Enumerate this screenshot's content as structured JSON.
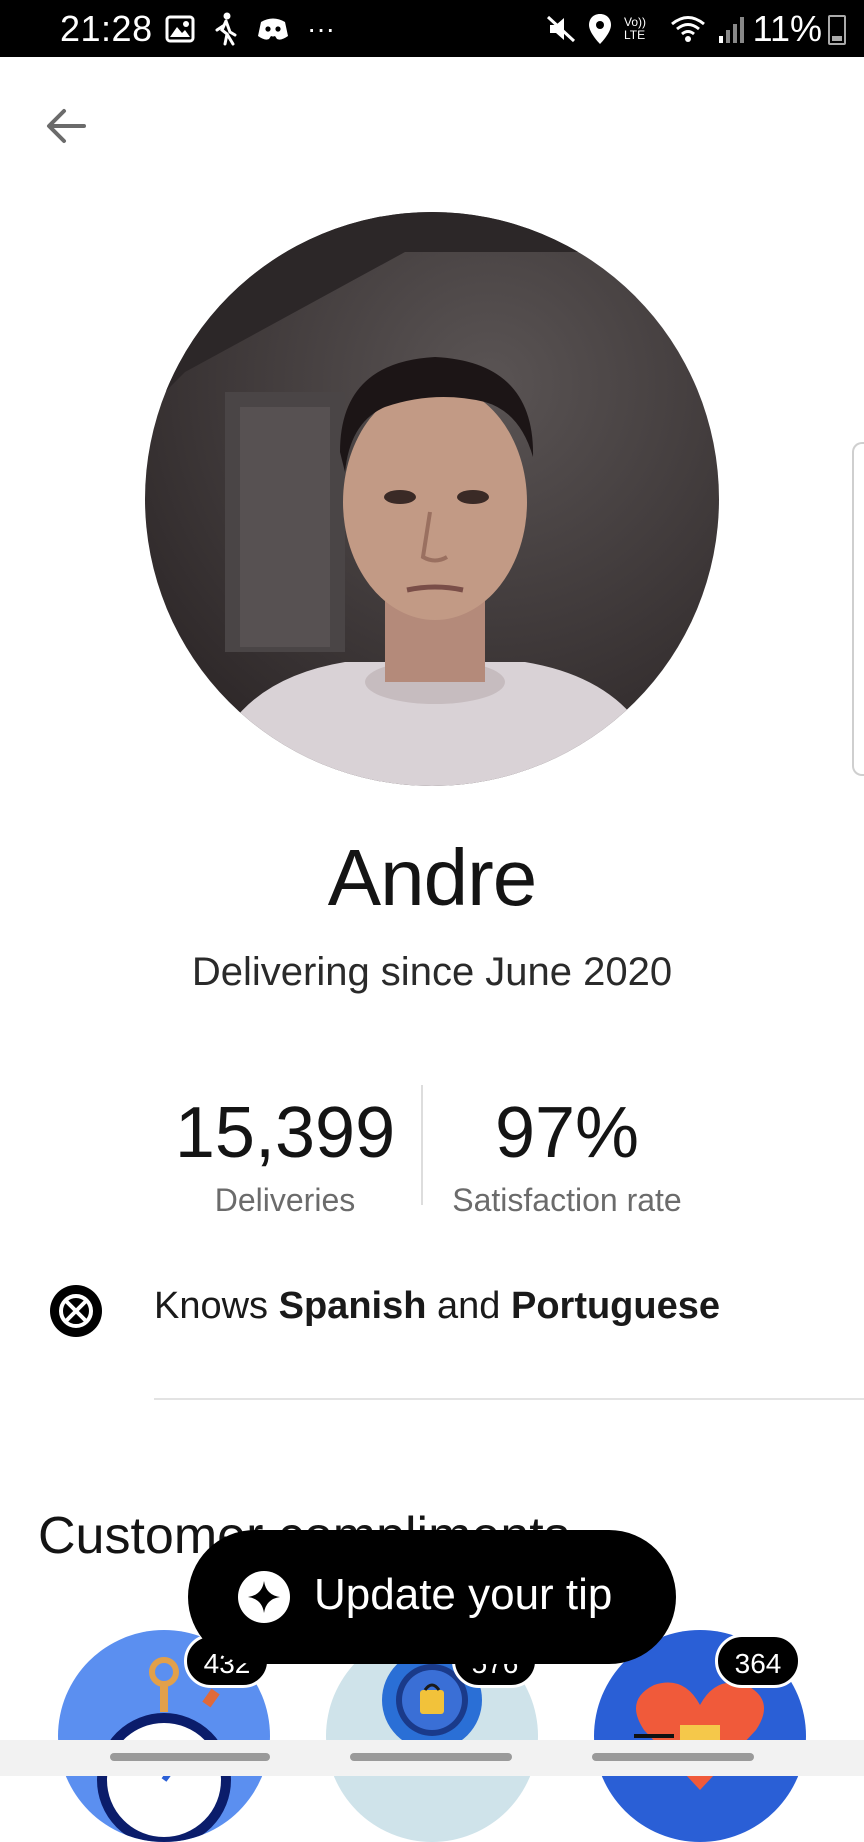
{
  "status_bar": {
    "time": "21:28",
    "left_icons": [
      "image-icon",
      "walking-icon",
      "discord-icon",
      "more-dots-icon"
    ],
    "right_icons": [
      "mute-icon",
      "location-icon",
      "volte-icon",
      "wifi-icon",
      "signal-icon"
    ],
    "volte_label": "Vo)) LTE",
    "battery": "11%",
    "more": "···"
  },
  "profile": {
    "name": "Andre",
    "subtitle": "Delivering since June 2020"
  },
  "stats": {
    "deliveries_value": "15,399",
    "deliveries_label": "Deliveries",
    "satisfaction_value": "97%",
    "satisfaction_label": "Satisfaction rate"
  },
  "languages": {
    "prefix": "Knows ",
    "first": "Spanish",
    "joiner": " and ",
    "second": "Portuguese"
  },
  "compliments": {
    "title": "Customer compliments",
    "badges": [
      {
        "count": "432",
        "icon": "stopwatch-icon",
        "color": "#5b8ff0"
      },
      {
        "count": "576",
        "icon": "shopping-bag-icon",
        "color": "#cfe3ea"
      },
      {
        "count": "364",
        "icon": "heart-gift-icon",
        "color": "#2a5fd6"
      }
    ]
  },
  "tip_button": {
    "label": "Update your tip",
    "icon": "sparkle-icon"
  },
  "colors": {
    "accent": "#000000",
    "text_primary": "#141414",
    "text_secondary": "#6b6b6b"
  }
}
